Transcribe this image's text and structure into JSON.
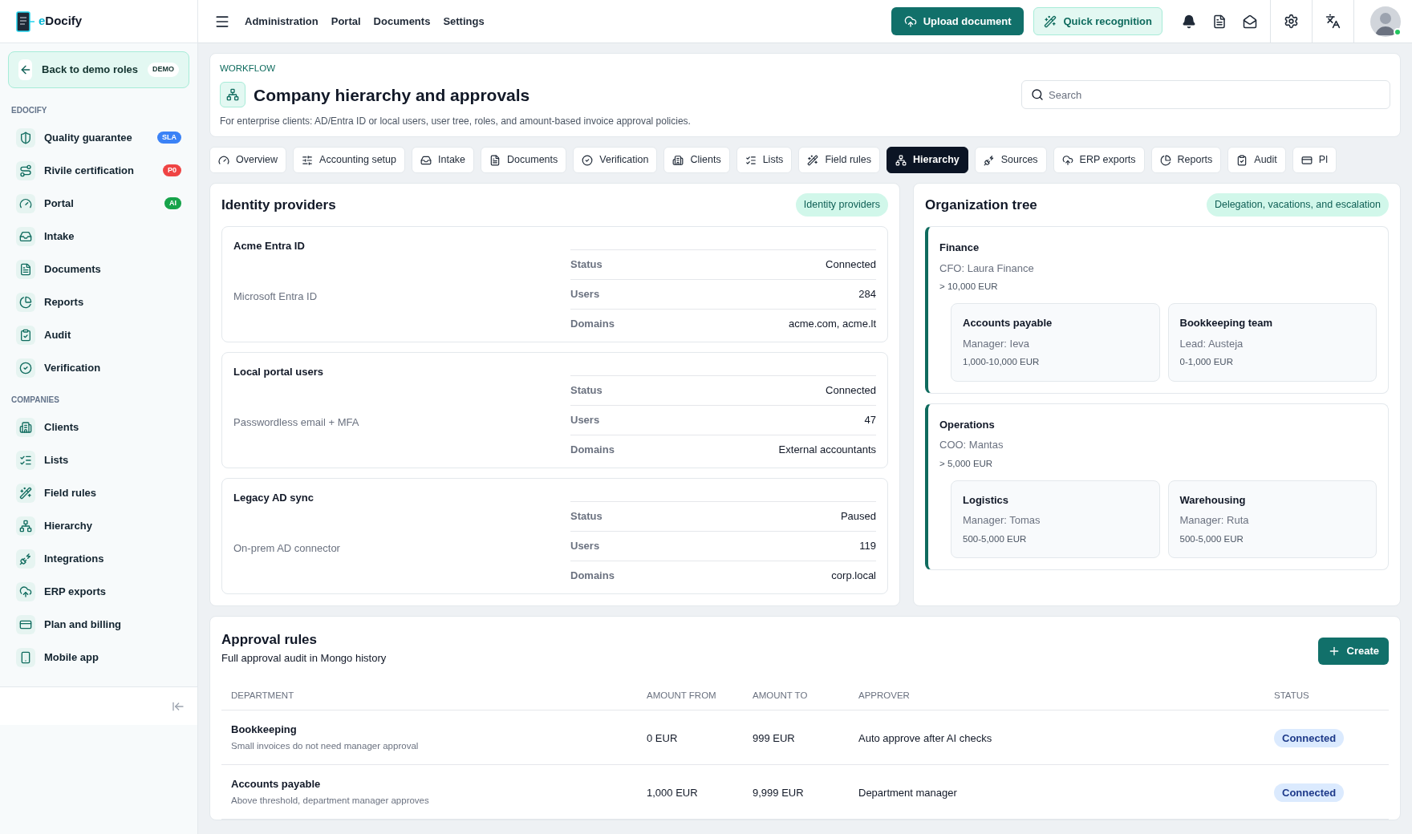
{
  "brand": {
    "prefix": "e",
    "name": "Docify"
  },
  "sidebar": {
    "back": {
      "label": "Back to demo roles",
      "badge": "DEMO"
    },
    "sections": [
      {
        "title": "EDOCIFY",
        "items": [
          {
            "label": "Quality guarantee",
            "kind": "shield",
            "badge": {
              "text": "SLA",
              "color": "#3b82f6"
            }
          },
          {
            "label": "Rivile certification",
            "kind": "route",
            "badge": {
              "text": "P0",
              "color": "#ef4444"
            }
          },
          {
            "label": "Portal",
            "kind": "gauge",
            "badge": {
              "text": "AI",
              "color": "#16a34a"
            }
          },
          {
            "label": "Intake",
            "kind": "inbox"
          },
          {
            "label": "Documents",
            "kind": "file"
          },
          {
            "label": "Reports",
            "kind": "pie"
          },
          {
            "label": "Audit",
            "kind": "clipboard"
          },
          {
            "label": "Verification",
            "kind": "check"
          }
        ]
      },
      {
        "title": "COMPANIES",
        "items": [
          {
            "label": "Clients",
            "kind": "building"
          },
          {
            "label": "Lists",
            "kind": "list"
          },
          {
            "label": "Field rules",
            "kind": "wand"
          },
          {
            "label": "Hierarchy",
            "kind": "network"
          },
          {
            "label": "Integrations",
            "kind": "plug"
          },
          {
            "label": "ERP exports",
            "kind": "cloud"
          },
          {
            "label": "Plan and billing",
            "kind": "card"
          },
          {
            "label": "Mobile app",
            "kind": "phone"
          }
        ]
      }
    ]
  },
  "topbar": {
    "menu": [
      "Administration",
      "Portal",
      "Documents",
      "Settings"
    ],
    "upload": "Upload document",
    "quick": "Quick recognition",
    "avatar": {
      "online": true
    }
  },
  "header": {
    "eyebrow": "WORKFLOW",
    "title": "Company hierarchy and approvals",
    "description": "For enterprise clients: AD/Entra ID or local users, user tree, roles, and amount-based invoice approval policies.",
    "search": {
      "placeholder": "Search"
    }
  },
  "tabs": [
    {
      "label": "Overview",
      "kind": "gauge",
      "selected": false
    },
    {
      "label": "Accounting setup",
      "kind": "sliders",
      "selected": false
    },
    {
      "label": "Intake",
      "kind": "inbox",
      "selected": false
    },
    {
      "label": "Documents",
      "kind": "file",
      "selected": false
    },
    {
      "label": "Verification",
      "kind": "check",
      "selected": false
    },
    {
      "label": "Clients",
      "kind": "building",
      "selected": false
    },
    {
      "label": "Lists",
      "kind": "list",
      "selected": false
    },
    {
      "label": "Field rules",
      "kind": "wand",
      "selected": false
    },
    {
      "label": "Hierarchy",
      "kind": "network",
      "selected": true
    },
    {
      "label": "Sources",
      "kind": "plug",
      "selected": false
    },
    {
      "label": "ERP exports",
      "kind": "cloud",
      "selected": false
    },
    {
      "label": "Reports",
      "kind": "pie",
      "selected": false
    },
    {
      "label": "Audit",
      "kind": "clipboard",
      "selected": false
    },
    {
      "label": "Pl",
      "kind": "card",
      "selected": false
    }
  ],
  "identity_providers": {
    "title": "Identity providers",
    "tag": "Identity providers",
    "providers": [
      {
        "name": "Acme Entra ID",
        "type": "Microsoft Entra ID",
        "fields": [
          {
            "label": "Status",
            "value": "Connected"
          },
          {
            "label": "Users",
            "value": "284"
          },
          {
            "label": "Domains",
            "value": "acme.com, acme.lt"
          }
        ]
      },
      {
        "name": "Local portal users",
        "type": "Passwordless email + MFA",
        "fields": [
          {
            "label": "Status",
            "value": "Connected"
          },
          {
            "label": "Users",
            "value": "47"
          },
          {
            "label": "Domains",
            "value": "External accountants"
          }
        ]
      },
      {
        "name": "Legacy AD sync",
        "type": "On-prem AD connector",
        "fields": [
          {
            "label": "Status",
            "value": "Paused"
          },
          {
            "label": "Users",
            "value": "119"
          },
          {
            "label": "Domains",
            "value": "corp.local"
          }
        ]
      }
    ]
  },
  "organization_tree": {
    "title": "Organization tree",
    "tag": "Delegation, vacations, and escalation",
    "units": [
      {
        "name": "Finance",
        "head": "CFO: Laura Finance",
        "limit": "> 10,000 EUR",
        "children": [
          {
            "name": "Accounts payable",
            "head": "Manager: Ieva",
            "limit": "1,000-10,000 EUR"
          },
          {
            "name": "Bookkeeping team",
            "head": "Lead: Austeja",
            "limit": "0-1,000 EUR"
          }
        ]
      },
      {
        "name": "Operations",
        "head": "COO: Mantas",
        "limit": "> 5,000 EUR",
        "children": [
          {
            "name": "Logistics",
            "head": "Manager: Tomas",
            "limit": "500-5,000 EUR"
          },
          {
            "name": "Warehousing",
            "head": "Manager: Ruta",
            "limit": "500-5,000 EUR"
          }
        ]
      }
    ]
  },
  "approval_rules": {
    "title": "Approval rules",
    "subtitle": "Full approval audit in Mongo history",
    "create": "Create",
    "columns": [
      "DEPARTMENT",
      "AMOUNT FROM",
      "AMOUNT TO",
      "APPROVER",
      "STATUS"
    ],
    "rows": [
      {
        "department": "Bookkeeping",
        "note": "Small invoices do not need manager approval",
        "from": "0 EUR",
        "to": "999 EUR",
        "approver": "Auto approve after AI checks",
        "status": "Connected"
      },
      {
        "department": "Accounts payable",
        "note": "Above threshold, department manager approves",
        "from": "1,000 EUR",
        "to": "9,999 EUR",
        "approver": "Department manager",
        "status": "Connected"
      }
    ]
  }
}
